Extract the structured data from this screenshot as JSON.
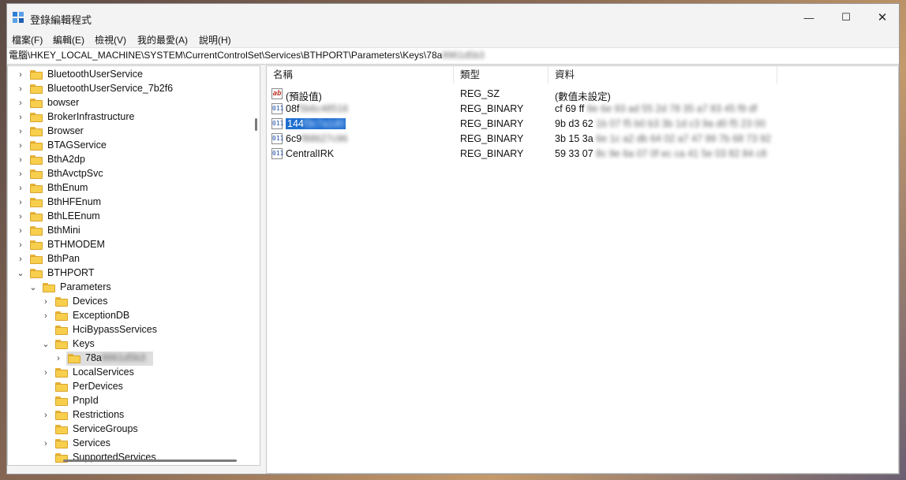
{
  "window": {
    "title": "登錄編輯程式",
    "minimize_label": "—",
    "maximize_label": "☐",
    "close_label": "✕"
  },
  "menu": [
    "檔案(F)",
    "編輯(E)",
    "檢視(V)",
    "我的最愛(A)",
    "說明(H)"
  ],
  "address": {
    "path": "電腦\\HKEY_LOCAL_MACHINE\\SYSTEM\\CurrentControlSet\\Services\\BTHPORT\\Parameters\\Keys\\78a",
    "blurred_suffix": "9961d5b3"
  },
  "tree": [
    {
      "label": "BluetoothUserService",
      "level": 1,
      "expander": "›"
    },
    {
      "label": "BluetoothUserService_7b2f6",
      "level": 1,
      "expander": "›"
    },
    {
      "label": "bowser",
      "level": 1,
      "expander": "›"
    },
    {
      "label": "BrokerInfrastructure",
      "level": 1,
      "expander": "›"
    },
    {
      "label": "Browser",
      "level": 1,
      "expander": "›"
    },
    {
      "label": "BTAGService",
      "level": 1,
      "expander": "›"
    },
    {
      "label": "BthA2dp",
      "level": 1,
      "expander": "›"
    },
    {
      "label": "BthAvctpSvc",
      "level": 1,
      "expander": "›"
    },
    {
      "label": "BthEnum",
      "level": 1,
      "expander": "›"
    },
    {
      "label": "BthHFEnum",
      "level": 1,
      "expander": "›"
    },
    {
      "label": "BthLEEnum",
      "level": 1,
      "expander": "›"
    },
    {
      "label": "BthMini",
      "level": 1,
      "expander": "›"
    },
    {
      "label": "BTHMODEM",
      "level": 1,
      "expander": "›"
    },
    {
      "label": "BthPan",
      "level": 1,
      "expander": "›"
    },
    {
      "label": "BTHPORT",
      "level": 1,
      "expander": "⌄"
    },
    {
      "label": "Parameters",
      "level": 2,
      "expander": "⌄"
    },
    {
      "label": "Devices",
      "level": 3,
      "expander": "›"
    },
    {
      "label": "ExceptionDB",
      "level": 3,
      "expander": "›"
    },
    {
      "label": "HciBypassServices",
      "level": 3,
      "expander": ""
    },
    {
      "label": "Keys",
      "level": 3,
      "expander": "⌄"
    },
    {
      "label": "78a",
      "level": 4,
      "expander": "›",
      "selected": true,
      "blurred_suffix": "9961d5b3"
    },
    {
      "label": "LocalServices",
      "level": 3,
      "expander": "›"
    },
    {
      "label": "PerDevices",
      "level": 3,
      "expander": ""
    },
    {
      "label": "PnpId",
      "level": 3,
      "expander": ""
    },
    {
      "label": "Restrictions",
      "level": 3,
      "expander": "›"
    },
    {
      "label": "ServiceGroups",
      "level": 3,
      "expander": ""
    },
    {
      "label": "Services",
      "level": 3,
      "expander": "›"
    },
    {
      "label": "SupportedServices",
      "level": 3,
      "expander": ""
    }
  ],
  "columns": {
    "name": "名稱",
    "type": "類型",
    "data": "資料"
  },
  "values": [
    {
      "icon": "ab",
      "name": "(預設值)",
      "name_blur": "",
      "type": "REG_SZ",
      "data": "(數值未設定)",
      "data_blur": ""
    },
    {
      "icon": "011",
      "name": "08f",
      "name_blur": "5b6c48516",
      "type": "REG_BINARY",
      "data": "cf 69 ff",
      "data_blur": "9e 6e 93 ad 55 2d 78 35 a7 83 45 f9 df"
    },
    {
      "icon": "011",
      "name": "144",
      "name_blur": "f3c7a1d0",
      "type": "REG_BINARY",
      "data": "9b d3 62",
      "data_blur": "1b 07 f5 b0 b3 3b 1d c3 9a d0 f5 23 00",
      "selected": true
    },
    {
      "icon": "011",
      "name": "6c9",
      "name_blur": "f88627c96",
      "type": "REG_BINARY",
      "data": "3b 15 3a",
      "data_blur": "6e 1c a2 db 64 02 a7 47 99 7b 68 73 92"
    },
    {
      "icon": "011",
      "name": "CentralIRK",
      "name_blur": "",
      "type": "REG_BINARY",
      "data": "59 33 07",
      "data_blur": "8c 9e 6a 07 0f ec ca 41 5e 03 82 84 c8"
    }
  ]
}
